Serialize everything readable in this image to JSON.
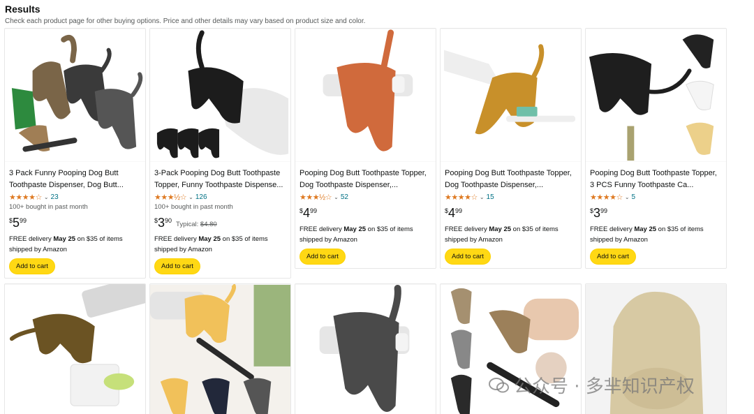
{
  "header": {
    "title": "Results",
    "subtitle": "Check each product page for other buying options. Price and other details may vary based on product size and color."
  },
  "colors": {
    "star": "#de7921",
    "link": "#007185",
    "button": "#ffd814",
    "strike": "#565959"
  },
  "products": [
    {
      "title": "3 Pack Funny Pooping Dog Butt Toothpaste Dispenser, Dog Butt...",
      "stars": "★★★★☆",
      "rating_chevron": "⌄",
      "rating_count": "23",
      "bought": "100+ bought in past month",
      "price_symbol": "$",
      "price_whole": "5",
      "price_fraction": "99",
      "typical_label": "",
      "typical_price": "",
      "delivery_prefix": "FREE delivery ",
      "delivery_date": "May 25",
      "delivery_suffix": " on $35 of items shipped by Amazon",
      "cart_label": "Add to cart"
    },
    {
      "title": "3-Pack Pooping Dog Butt Toothpaste Topper, Funny Toothpaste Dispense...",
      "stars": "★★★½☆",
      "rating_chevron": "⌄",
      "rating_count": "126",
      "bought": "100+ bought in past month",
      "price_symbol": "$",
      "price_whole": "3",
      "price_fraction": "90",
      "typical_label": "Typical: ",
      "typical_price": "$4.80",
      "delivery_prefix": "FREE delivery ",
      "delivery_date": "May 25",
      "delivery_suffix": " on $35 of items shipped by Amazon",
      "cart_label": "Add to cart"
    },
    {
      "title": "Pooping Dog Butt Toothpaste Topper, Dog Toothpaste Dispenser,...",
      "stars": "★★★½☆",
      "rating_chevron": "⌄",
      "rating_count": "52",
      "bought": "",
      "price_symbol": "$",
      "price_whole": "4",
      "price_fraction": "99",
      "typical_label": "",
      "typical_price": "",
      "delivery_prefix": "FREE delivery ",
      "delivery_date": "May 25",
      "delivery_suffix": " on $35 of items shipped by Amazon",
      "cart_label": "Add to cart"
    },
    {
      "title": "Pooping Dog Butt Toothpaste Topper, Dog Toothpaste Dispenser,...",
      "stars": "★★★★☆",
      "rating_chevron": "⌄",
      "rating_count": "15",
      "bought": "",
      "price_symbol": "$",
      "price_whole": "4",
      "price_fraction": "99",
      "typical_label": "",
      "typical_price": "",
      "delivery_prefix": "FREE delivery ",
      "delivery_date": "May 25",
      "delivery_suffix": " on $35 of items shipped by Amazon",
      "cart_label": "Add to cart"
    },
    {
      "title": "Pooping Dog Butt Toothpaste Topper, 3 PCS Funny Toothpaste Ca...",
      "stars": "★★★★☆",
      "rating_chevron": "⌄",
      "rating_count": "5",
      "bought": "",
      "price_symbol": "$",
      "price_whole": "3",
      "price_fraction": "99",
      "typical_label": "",
      "typical_price": "",
      "delivery_prefix": "FREE delivery ",
      "delivery_date": "May 25",
      "delivery_suffix": " on $35 of items shipped by Amazon",
      "cart_label": "Add to cart"
    }
  ],
  "watermark": {
    "text": "公众号 · 多芈知识产权"
  }
}
